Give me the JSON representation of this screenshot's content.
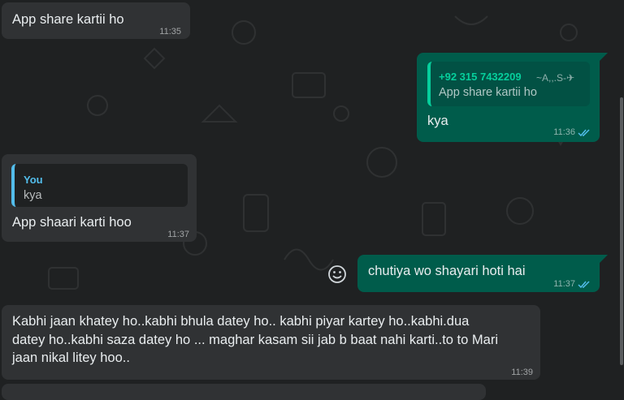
{
  "messages": [
    {
      "id": "m1",
      "text": "App share kartii ho",
      "time": "11:35"
    },
    {
      "id": "m2",
      "quote": {
        "sender": "+92 315 7432209",
        "sender_alias": "~A,,.S-✈",
        "text": "App share kartii ho"
      },
      "text": "kya",
      "time": "11:36"
    },
    {
      "id": "m3",
      "quote": {
        "sender": "You",
        "text": "kya"
      },
      "text": "App shaari karti hoo",
      "time": "11:37"
    },
    {
      "id": "m4",
      "text": "chutiya wo shayari hoti hai",
      "time": "11:37"
    },
    {
      "id": "m5",
      "lines": [
        "Kabhi jaan khatey ho..kabhi bhula datey ho.. kabhi piyar kartey ho..kabhi.dua",
        "datey ho..kabhi saza datey ho ... maghar kasam sii jab b baat nahi karti..to to Mari",
        "jaan nikal litey hoo.."
      ],
      "time": "11:39"
    }
  ],
  "icons": {
    "emoji_react": "smiley-icon",
    "read_receipt": "double-check-icon"
  },
  "colors": {
    "background": "#1f2122",
    "incoming_bubble": "#303234",
    "outgoing_bubble": "#005c4b",
    "quote_in_incoming": "#1f2122",
    "quote_in_outgoing": "#025144",
    "sender_green": "#06cf9c",
    "you_blue": "#53bdeb",
    "read_tick": "#53bdeb"
  }
}
